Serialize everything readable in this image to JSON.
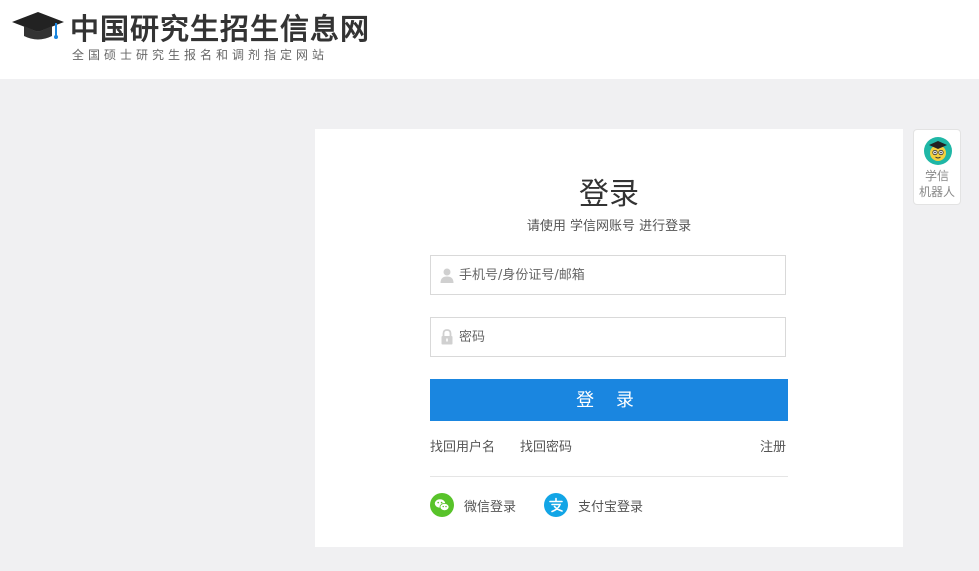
{
  "header": {
    "title": "中国研究生招生信息网",
    "subtitle": "全国硕士研究生报名和调剂指定网站"
  },
  "login": {
    "title": "登录",
    "subtitle": "请使用 学信网账号 进行登录",
    "username_placeholder": "手机号/身份证号/邮箱",
    "password_placeholder": "密码",
    "submit_label": "登 录",
    "links": {
      "find_username": "找回用户名",
      "find_password": "找回密码",
      "register": "注册"
    },
    "social": {
      "wechat_label": "微信登录",
      "alipay_label": "支付宝登录"
    }
  },
  "robot": {
    "label_line1": "学信",
    "label_line2": "机器人"
  },
  "colors": {
    "primary": "#1a86e0",
    "wechat": "#58c32a",
    "alipay": "#12a5e6",
    "background": "#f0f0f2"
  },
  "icons": {
    "logo": "graduation-cap-icon",
    "username": "user-icon",
    "password": "lock-icon",
    "wechat": "wechat-icon",
    "alipay": "alipay-icon",
    "robot": "robot-avatar-icon"
  }
}
